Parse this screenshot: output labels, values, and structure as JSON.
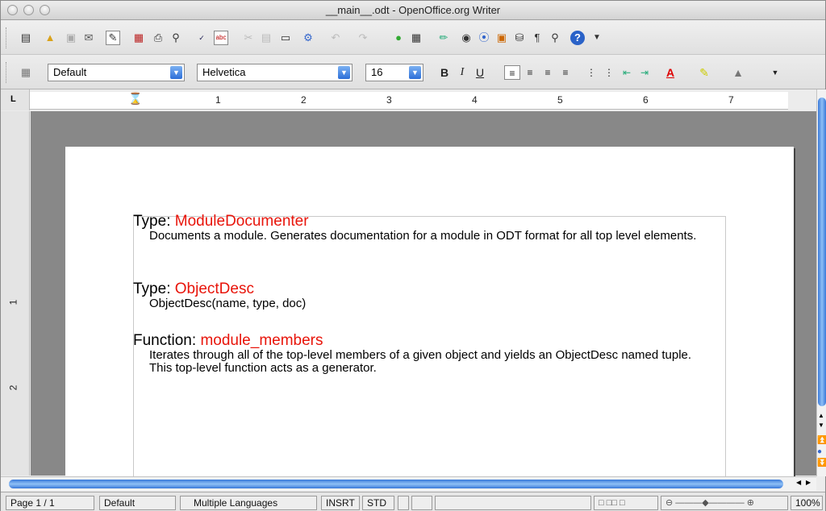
{
  "window": {
    "title": "__main__.odt - OpenOffice.org Writer"
  },
  "formatting": {
    "style": "Default",
    "font": "Helvetica",
    "size": "16"
  },
  "ruler": {
    "numbers": [
      "1",
      "2",
      "3",
      "4",
      "5",
      "6",
      "7"
    ]
  },
  "vruler": {
    "numbers": [
      "1",
      "2"
    ]
  },
  "document": {
    "entries": [
      {
        "kind": "Type: ",
        "name": "ModuleDocumenter",
        "desc": "Documents a module. Generates documentation for a module in ODT format for all top level elements."
      },
      {
        "kind": "Type: ",
        "name": "ObjectDesc",
        "desc": "ObjectDesc(name, type, doc)"
      },
      {
        "kind": "Function: ",
        "name": "module_members",
        "desc": "Iterates through all of the top-level members of a given object and yields an ObjectDesc named tuple. This top-level function acts as a generator."
      }
    ]
  },
  "status": {
    "page": "Page 1 / 1",
    "style": "Default",
    "language": "Multiple Languages",
    "insert_mode": "INSRT",
    "selection_mode": "STD",
    "zoom": "100%"
  },
  "icons": {
    "help": "?",
    "bold": "B",
    "italic": "I",
    "underline": "U"
  }
}
